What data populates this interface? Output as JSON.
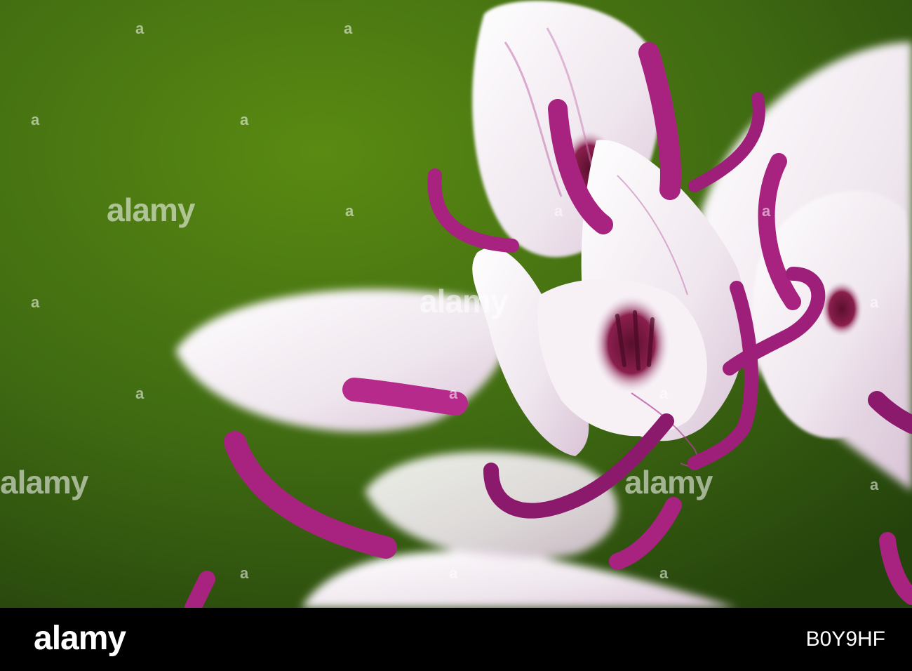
{
  "photo": {
    "subject": "orchid-flower",
    "background_color": "#3f6a12",
    "petal_color": "#f3eef2",
    "accent_color": "#a8237f"
  },
  "watermark": {
    "text": "alamy",
    "mark": "a"
  },
  "footer": {
    "logo_text": "alamy",
    "image_id": "B0Y9HF"
  }
}
